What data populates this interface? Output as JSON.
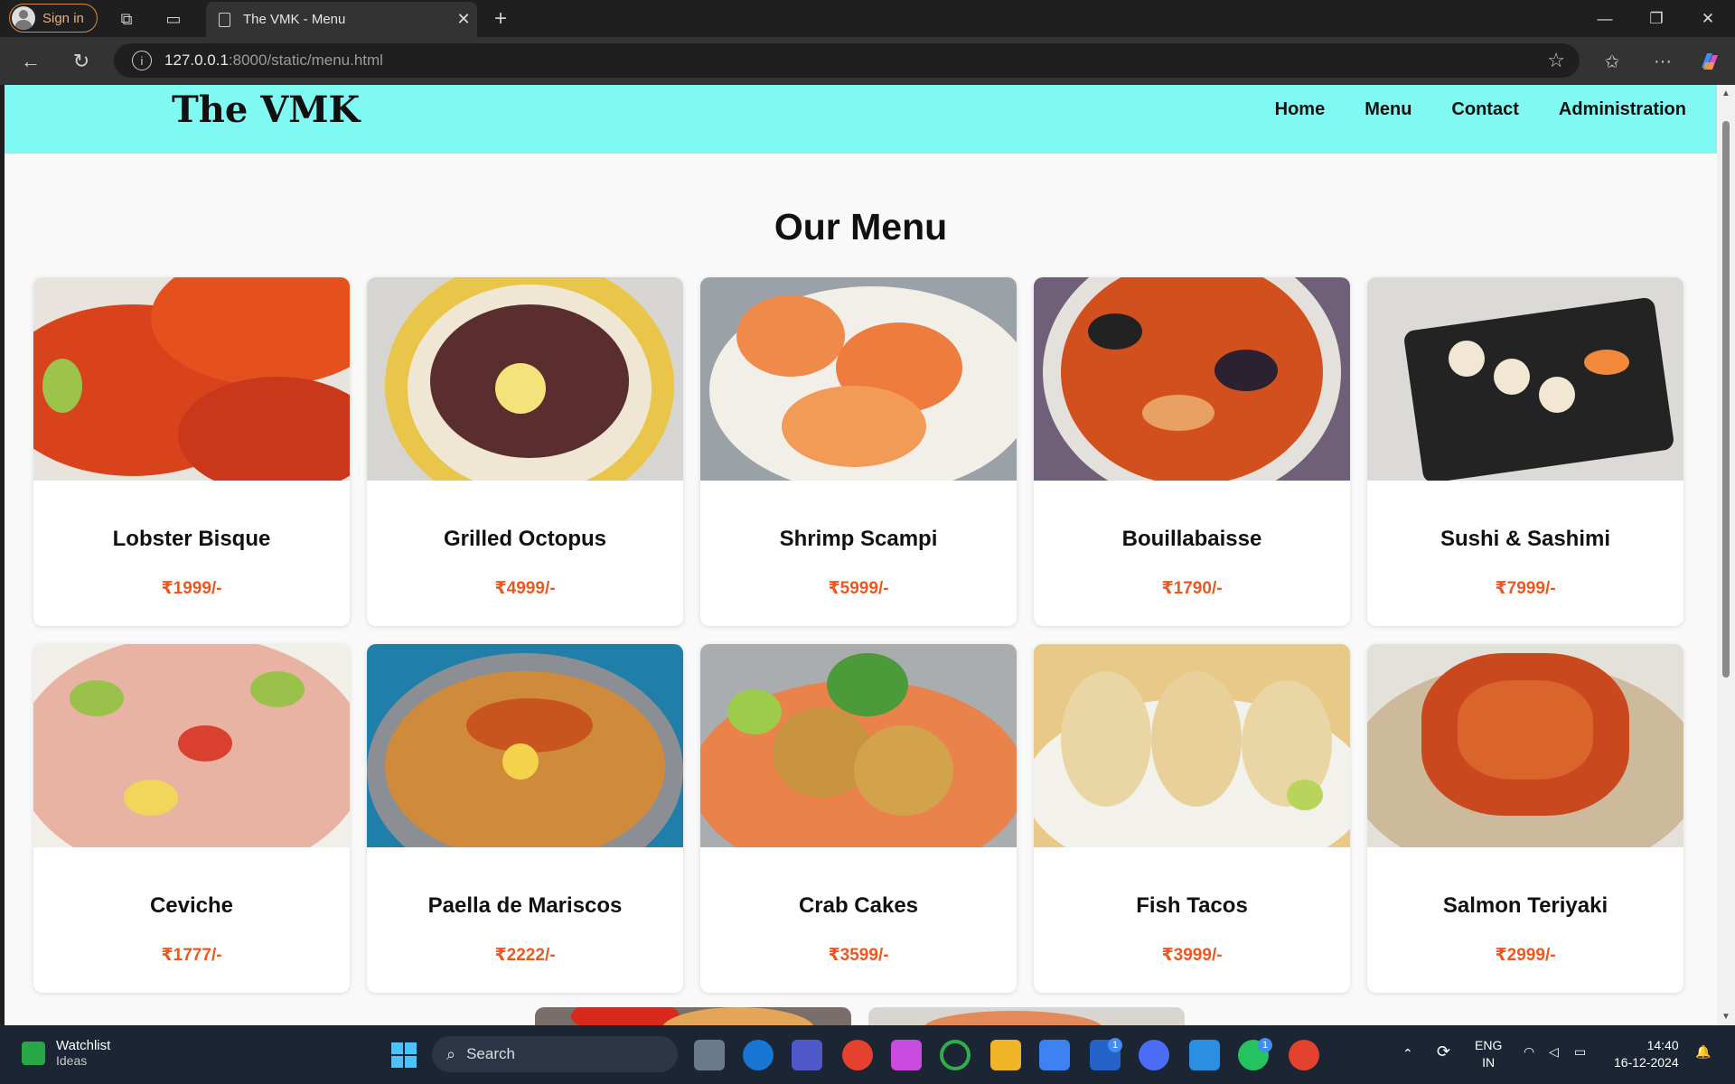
{
  "browser": {
    "signin_label": "Sign in",
    "tab_title": "The VMK - Menu",
    "url_host": "127.0.0.1",
    "url_path": ":8000/static/menu.html"
  },
  "site": {
    "brand": "The VMK",
    "nav": [
      "Home",
      "Menu",
      "Contact",
      "Administration"
    ],
    "menu_title": "Our Menu"
  },
  "menu_items": [
    {
      "name": "Lobster Bisque",
      "price": "₹1999/-"
    },
    {
      "name": "Grilled Octopus",
      "price": "₹4999/-"
    },
    {
      "name": "Shrimp Scampi",
      "price": "₹5999/-"
    },
    {
      "name": "Bouillabaisse",
      "price": "₹1790/-"
    },
    {
      "name": "Sushi & Sashimi",
      "price": "₹7999/-"
    },
    {
      "name": "Ceviche",
      "price": "₹1777/-"
    },
    {
      "name": "Paella de Mariscos",
      "price": "₹2222/-"
    },
    {
      "name": "Crab Cakes",
      "price": "₹3599/-"
    },
    {
      "name": "Fish Tacos",
      "price": "₹3999/-"
    },
    {
      "name": "Salmon Teriyaki",
      "price": "₹2999/-"
    }
  ],
  "colors": {
    "header_bg": "#7ff9f1",
    "price": "#f0571f"
  },
  "taskbar": {
    "widget_title": "Watchlist",
    "widget_sub": "Ideas",
    "search_label": "Search",
    "lang_top": "ENG",
    "lang_bottom": "IN",
    "time": "14:40",
    "date": "16-12-2024",
    "teams_badge": "1",
    "l_badge": "1",
    "whatsapp_badge": "1"
  }
}
